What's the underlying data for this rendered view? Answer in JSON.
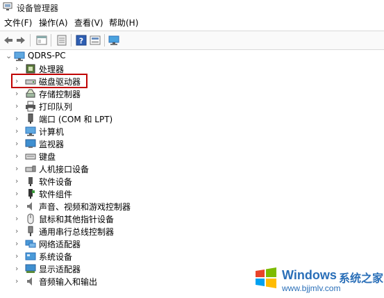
{
  "window": {
    "title": "设备管理器"
  },
  "menu": [
    {
      "label": "文件(F)"
    },
    {
      "label": "操作(A)"
    },
    {
      "label": "查看(V)"
    },
    {
      "label": "帮助(H)"
    }
  ],
  "toolbar": {
    "buttons": [
      "back-icon",
      "forward-icon",
      "properties-icon",
      "update-icon",
      "help-icon",
      "view-icon",
      "scan-icon"
    ]
  },
  "tree": {
    "root": {
      "label": "QDRS-PC",
      "icon": "computer-icon",
      "expanded": true
    },
    "items": [
      {
        "label": "处理器",
        "icon": "processor-icon"
      },
      {
        "label": "磁盘驱动器",
        "icon": "disk-drive-icon",
        "highlighted": true
      },
      {
        "label": "存储控制器",
        "icon": "storage-controller-icon"
      },
      {
        "label": "打印队列",
        "icon": "printer-icon"
      },
      {
        "label": "端口 (COM 和 LPT)",
        "icon": "port-icon"
      },
      {
        "label": "计算机",
        "icon": "computer-icon"
      },
      {
        "label": "监视器",
        "icon": "monitor-icon"
      },
      {
        "label": "键盘",
        "icon": "keyboard-icon"
      },
      {
        "label": "人机接口设备",
        "icon": "hid-icon"
      },
      {
        "label": "软件设备",
        "icon": "software-device-icon"
      },
      {
        "label": "软件组件",
        "icon": "software-component-icon"
      },
      {
        "label": "声音、视频和游戏控制器",
        "icon": "sound-icon"
      },
      {
        "label": "鼠标和其他指针设备",
        "icon": "mouse-icon"
      },
      {
        "label": "通用串行总线控制器",
        "icon": "usb-icon"
      },
      {
        "label": "网络适配器",
        "icon": "network-icon"
      },
      {
        "label": "系统设备",
        "icon": "system-device-icon"
      },
      {
        "label": "显示适配器",
        "icon": "display-adapter-icon"
      },
      {
        "label": "音频输入和输出",
        "icon": "audio-io-icon"
      }
    ]
  },
  "watermark": {
    "brand": "Windows",
    "suffix": "系统之家",
    "url": "www.bjjmlv.com"
  },
  "colors": {
    "highlight_border": "#c00000",
    "watermark": "#2a6fb8"
  }
}
